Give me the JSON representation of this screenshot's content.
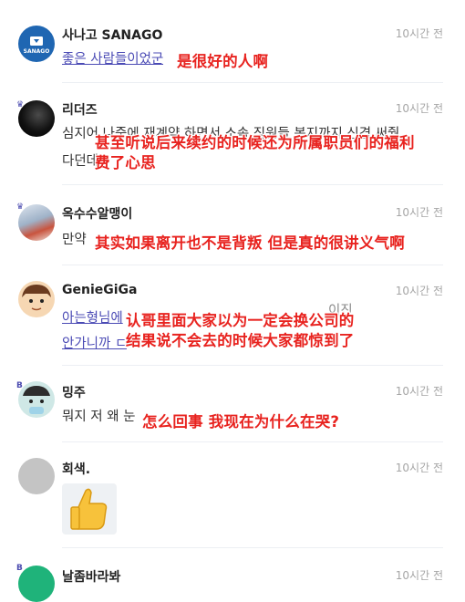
{
  "comments": [
    {
      "author": "사나고 SANAGO",
      "time": "10시간 전",
      "text": "좋은 사람들이었군",
      "avatar_text": "SANAGO",
      "subtitle": "是很好的人啊"
    },
    {
      "author": "리더즈",
      "time": "10시간 전",
      "text_line1": "심지어 나중에 재계약 하면서 소속 직원들 복지까지 신경 써줬",
      "text_line2": "다던데",
      "subtitle_line1": "甚至听说后来续约的时候还为所属职员们的福利",
      "subtitle_line2": "费了心思"
    },
    {
      "author": "옥수수알맹이",
      "time": "10시간 전",
      "text": "만약",
      "subtitle": "其实如果离开也不是背叛 但是真的很讲义气啊"
    },
    {
      "author": "GenieGiGa",
      "time": "10시간 전",
      "text_line1": "아는형님에",
      "text_line1_tail": "이진",
      "text_line2": "안가니까 ㄷ",
      "subtitle_line1": "认哥里面大家以为一定会换公司的",
      "subtitle_line2": "结果说不会去的时候大家都惊到了"
    },
    {
      "author": "밍주",
      "time": "10시간 전",
      "text": "뭐지 저 왜 눈",
      "subtitle": "怎么回事 我现在为什么在哭?"
    },
    {
      "author": "회색.",
      "time": "10시간 전",
      "sticker": "thumbs-up"
    },
    {
      "author": "날좀바라봐",
      "time": "10시간 전"
    }
  ],
  "colors": {
    "subtitle": "#e8231f",
    "mention": "#4b4bb5",
    "time": "#a6a6a6",
    "sanago_avatar": "#1f66b2"
  }
}
